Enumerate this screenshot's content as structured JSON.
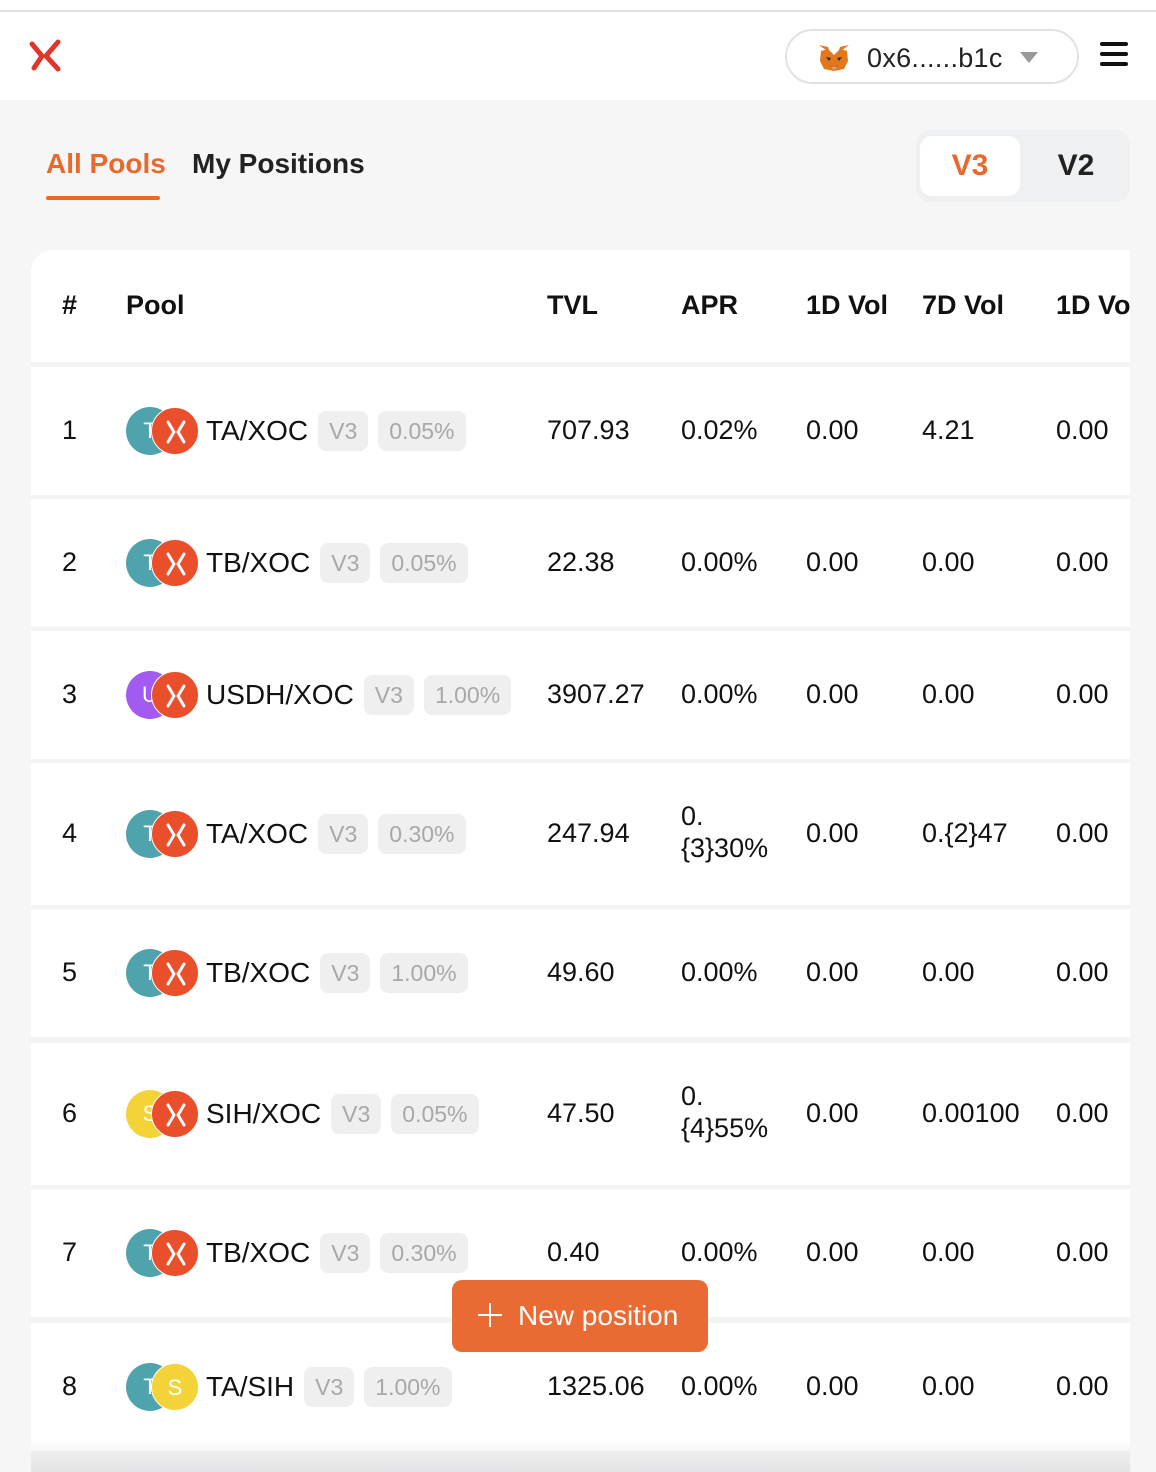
{
  "header": {
    "wallet_address": "0x6......b1c",
    "logo_icon": "brand-x-logo",
    "wallet_icon": "metamask-fox-icon",
    "menu_icon": "hamburger-menu-icon"
  },
  "tabs": [
    {
      "label": "All Pools",
      "active": true
    },
    {
      "label": "My Positions",
      "active": false
    }
  ],
  "version_toggle": {
    "v3": "V3",
    "v2": "V2",
    "selected": "V3"
  },
  "table": {
    "headers": {
      "index": "#",
      "pool": "Pool",
      "tvl": "TVL",
      "apr": "APR",
      "vol1d": "1D Vol",
      "vol7d": "7D Vol",
      "vol1d_extra": "1D Vo"
    },
    "rows": [
      {
        "index": "1",
        "token_a": "T",
        "token_a_color": "#4ea3ad",
        "token_b": "X",
        "pair": "TA/XOC",
        "version": "V3",
        "fee": "0.05%",
        "tvl": "707.93",
        "apr": "0.02%",
        "vol1d": "0.00",
        "vol7d": "4.21",
        "extra": "0.00"
      },
      {
        "index": "2",
        "token_a": "T",
        "token_a_color": "#4ea3ad",
        "token_b": "X",
        "pair": "TB/XOC",
        "version": "V3",
        "fee": "0.05%",
        "tvl": "22.38",
        "apr": "0.00%",
        "vol1d": "0.00",
        "vol7d": "0.00",
        "extra": "0.00"
      },
      {
        "index": "3",
        "token_a": "U",
        "token_a_color": "#a25af0",
        "token_b": "X",
        "pair": "USDH/XOC",
        "version": "V3",
        "fee": "1.00%",
        "tvl": "3907.27",
        "apr": "0.00%",
        "vol1d": "0.00",
        "vol7d": "0.00",
        "extra": "0.00"
      },
      {
        "index": "4",
        "token_a": "T",
        "token_a_color": "#4ea3ad",
        "token_b": "X",
        "pair": "TA/XOC",
        "version": "V3",
        "fee": "0.30%",
        "tvl": "247.94",
        "apr": "0.{3}30%",
        "vol1d": "0.00",
        "vol7d": "0.{2}47",
        "extra": "0.00"
      },
      {
        "index": "5",
        "token_a": "T",
        "token_a_color": "#4ea3ad",
        "token_b": "X",
        "pair": "TB/XOC",
        "version": "V3",
        "fee": "1.00%",
        "tvl": "49.60",
        "apr": "0.00%",
        "vol1d": "0.00",
        "vol7d": "0.00",
        "extra": "0.00"
      },
      {
        "index": "6",
        "token_a": "S",
        "token_a_color": "#f3d338",
        "token_b": "X",
        "pair": "SIH/XOC",
        "version": "V3",
        "fee": "0.05%",
        "tvl": "47.50",
        "apr": "0.{4}55%",
        "vol1d": "0.00",
        "vol7d": "0.00100",
        "extra": "0.00"
      },
      {
        "index": "7",
        "token_a": "T",
        "token_a_color": "#4ea3ad",
        "token_b": "X",
        "pair": "TB/XOC",
        "version": "V3",
        "fee": "0.30%",
        "tvl": "0.40",
        "apr": "0.00%",
        "vol1d": "0.00",
        "vol7d": "0.00",
        "extra": "0.00"
      },
      {
        "index": "8",
        "token_a": "T",
        "token_a_color": "#4ea3ad",
        "token_b": "S",
        "token_b_color": "#f3d338",
        "pair": "TA/SIH",
        "version": "V3",
        "fee": "1.00%",
        "tvl": "1325.06",
        "apr": "0.00%",
        "vol1d": "0.00",
        "vol7d": "0.00",
        "extra": "0.00"
      }
    ]
  },
  "fab": {
    "label": "New position",
    "icon": "plus-icon"
  },
  "colors": {
    "accent": "#e8692c",
    "xoc_token": "#ea4f2b"
  }
}
